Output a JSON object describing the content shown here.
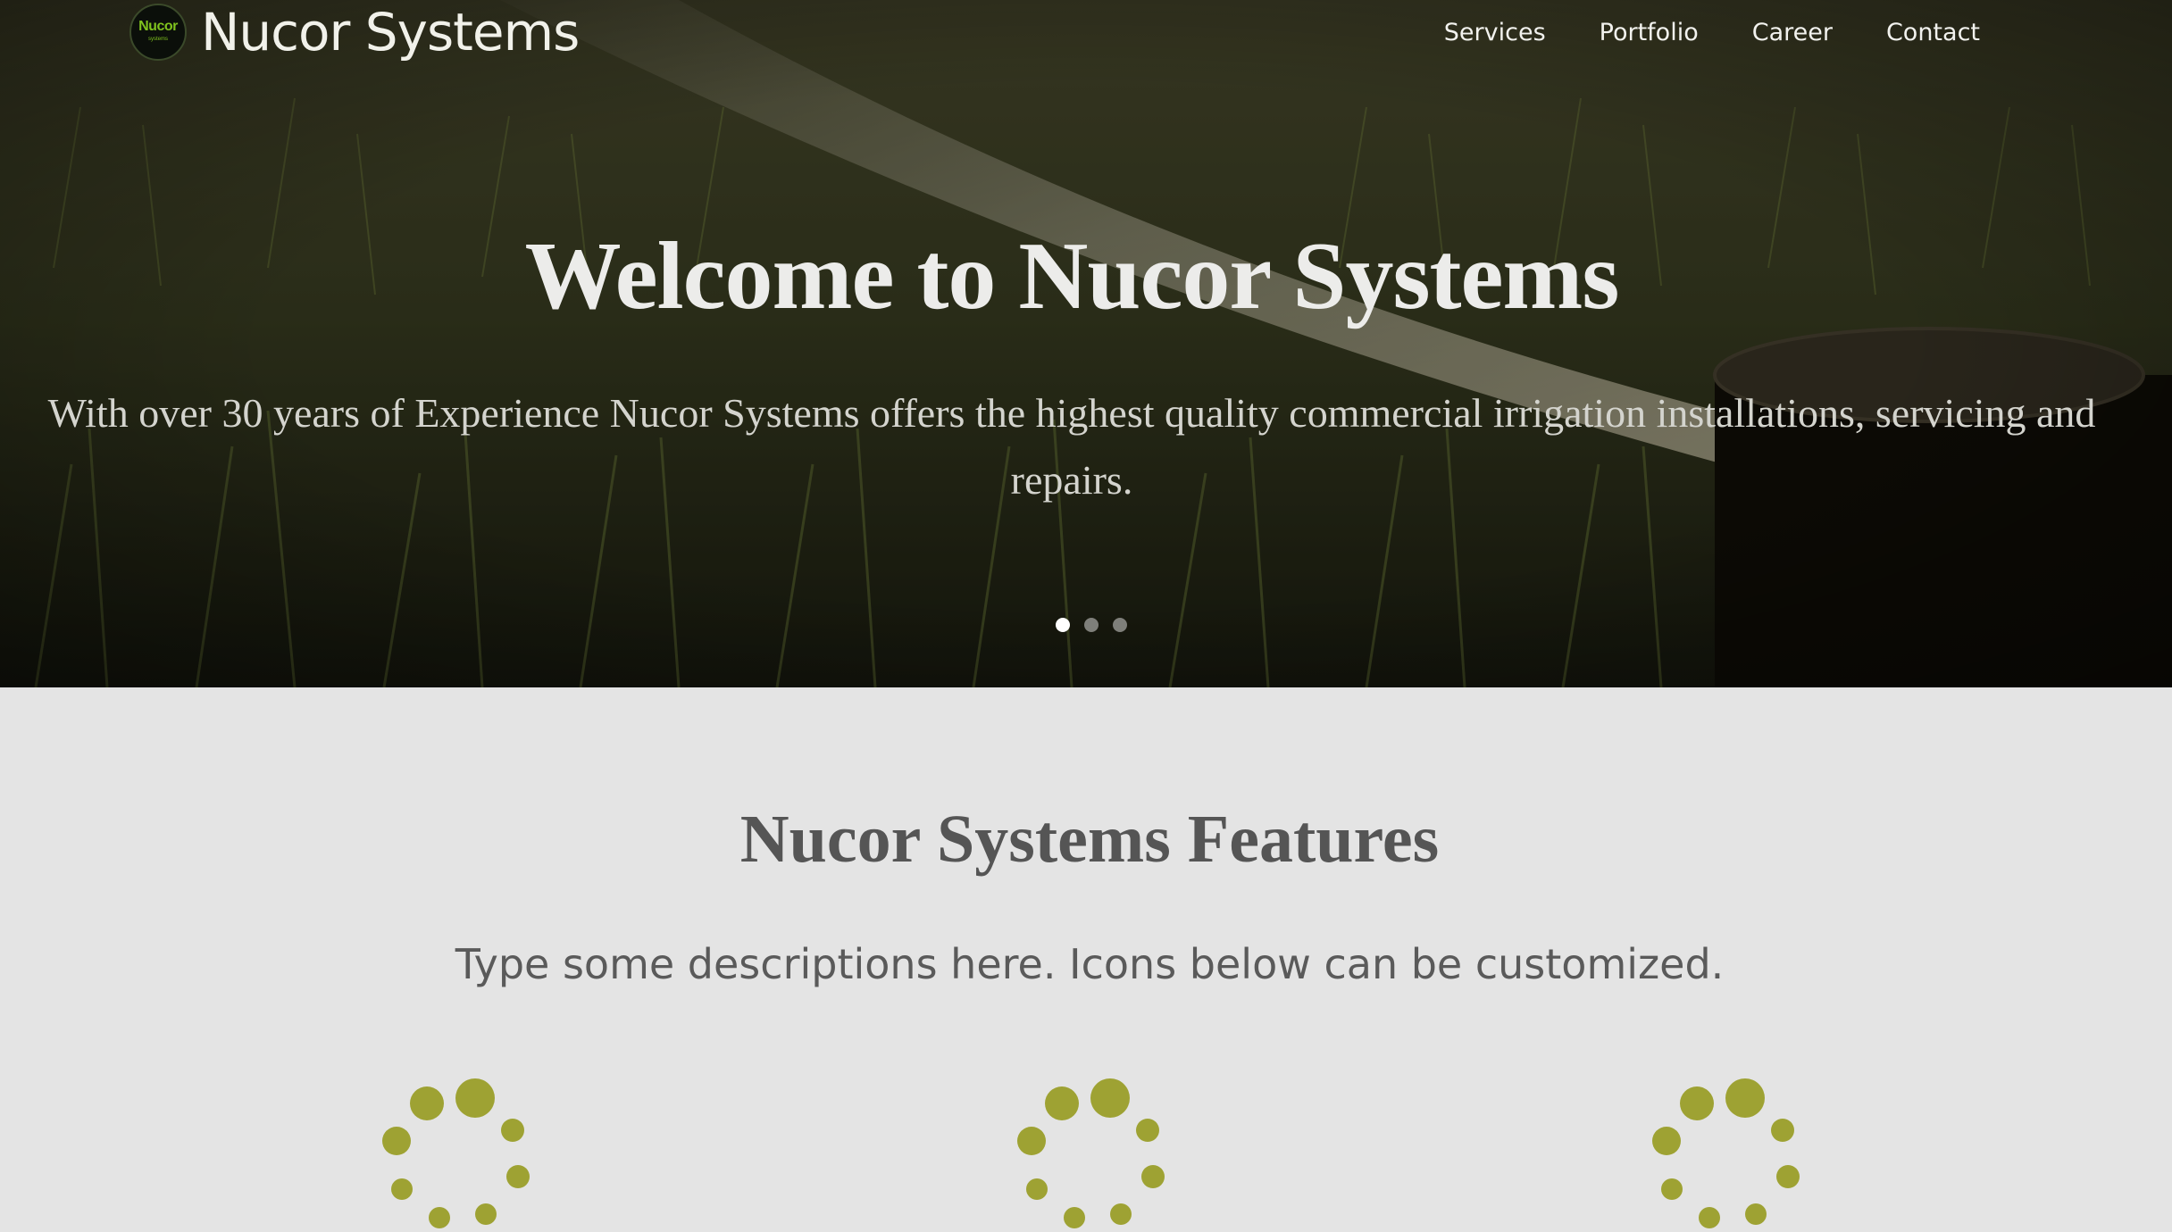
{
  "brand": {
    "logo_text": "Nucor",
    "logo_subtext": "systems",
    "name": "Nucor Systems"
  },
  "nav": {
    "items": [
      {
        "label": "Services"
      },
      {
        "label": "Portfolio"
      },
      {
        "label": "Career"
      },
      {
        "label": "Contact"
      }
    ]
  },
  "hero": {
    "title": "Welcome to Nucor Systems",
    "subtitle_line1": "With over 30 years of Experience Nucor Systems offers the highest quality commercial irrigation installations, servicing and",
    "subtitle_line2": "repairs.",
    "slides_total": 3,
    "active_slide": 1
  },
  "features": {
    "title": "Nucor Systems Features",
    "description": "Type some descriptions here. Icons below can be customized.",
    "icons": [
      {
        "name": "loading-spinner-icon"
      },
      {
        "name": "loading-spinner-icon"
      },
      {
        "name": "loading-spinner-icon"
      }
    ]
  },
  "colors": {
    "accent": "#9ea233",
    "logo_green": "#7fc21e",
    "section_bg": "#e4e4e4",
    "heading": "#555555"
  }
}
